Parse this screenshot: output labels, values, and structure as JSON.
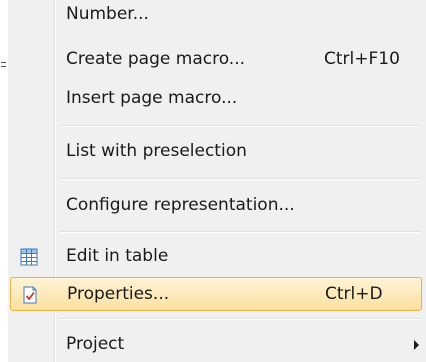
{
  "menu": {
    "items": [
      {
        "label": "Number...",
        "shortcut": ""
      },
      {
        "label": "Create page macro...",
        "shortcut": "Ctrl+F10"
      },
      {
        "label": "Insert page macro...",
        "shortcut": ""
      },
      {
        "label": "List with preselection",
        "shortcut": ""
      },
      {
        "label": "Configure representation...",
        "shortcut": ""
      },
      {
        "label": "Edit in table",
        "shortcut": "",
        "icon": "table-icon"
      },
      {
        "label": "Properties...",
        "shortcut": "Ctrl+D",
        "icon": "properties-icon",
        "highlighted": true
      },
      {
        "label": "Project",
        "shortcut": "",
        "submenu": true
      }
    ]
  },
  "colors": {
    "menu_background": "#f0f0f0",
    "highlight_border": "#e8b44a",
    "highlight_fill": "#fbe0a0",
    "text": "#1a1a1a"
  }
}
